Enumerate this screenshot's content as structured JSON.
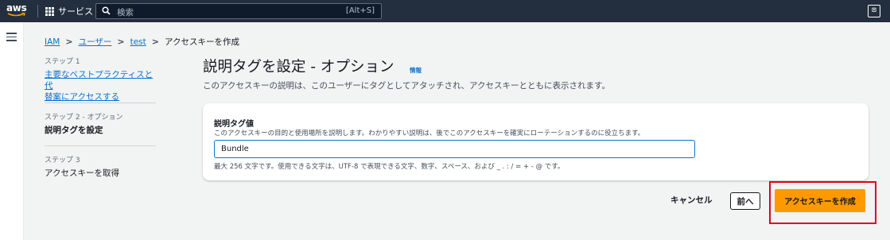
{
  "topnav": {
    "logo": "aws",
    "services_label": "サービス",
    "search_placeholder": "検索",
    "search_shortcut": "[Alt+S]",
    "cloudshell_glyph": "⊡",
    "bg_color": "#232f3e"
  },
  "breadcrumb": {
    "items": [
      "IAM",
      "ユーザー",
      "test",
      "アクセスキーを作成"
    ]
  },
  "steps": [
    {
      "label": "ステップ 1",
      "title": "主要なベストプラクティスと代替案にアクセスする",
      "title_line1": "主要なベストプラクティスと代",
      "title_line2": "替案にアクセスする"
    },
    {
      "label": "ステップ 2 - オプション",
      "title": "説明タグを設定"
    },
    {
      "label": "ステップ 3",
      "title": "アクセスキーを取得"
    }
  ],
  "main": {
    "title": "説明タグを設定 - オプション",
    "info": "情報",
    "description": "このアクセスキーの説明は、このユーザーにタグとしてアタッチされ、アクセスキーとともに表示されます。"
  },
  "form": {
    "field_label": "説明タグ値",
    "field_description": "このアクセスキーの目的と使用場所を説明します。わかりやすい説明は、後でこのアクセスキーを確実にローテーションするのに役立ちます。",
    "field_value": "Bundle",
    "field_constraint": "最大 256 文字です。使用できる文字は、UTF-8 で表現できる文字、数字、スペース、および _ . : / = + - @ です。"
  },
  "actions": {
    "cancel": "キャンセル",
    "previous": "前へ",
    "create": "アクセスキーを作成",
    "accent_color": "#ff9900",
    "highlight_color": "#e3001b"
  }
}
